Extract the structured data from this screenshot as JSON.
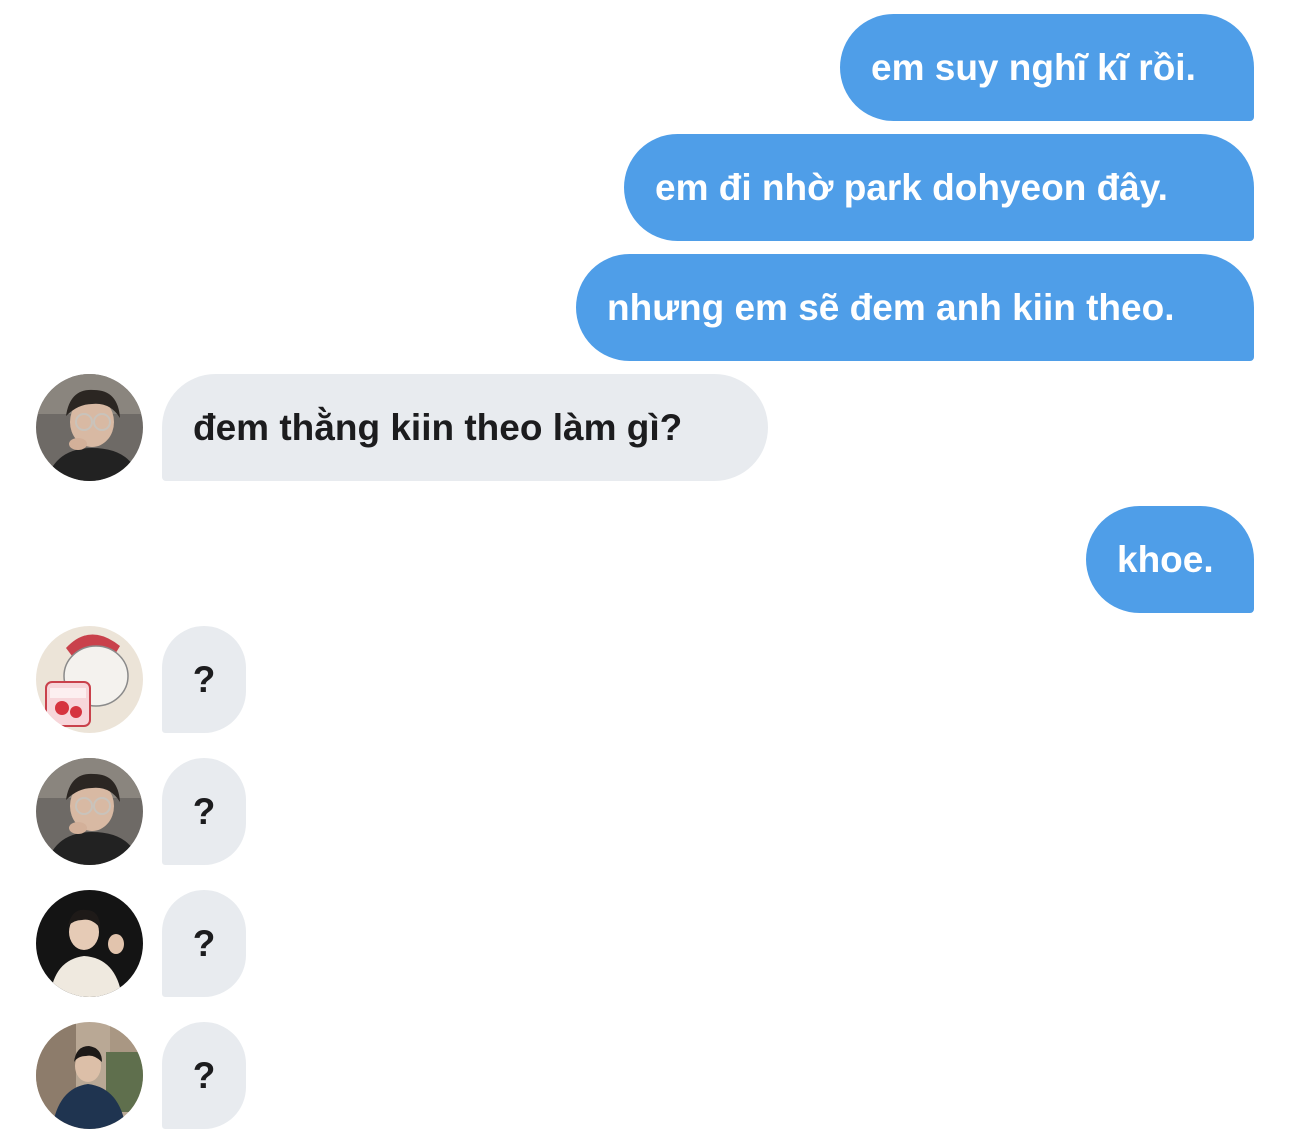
{
  "messages": [
    {
      "direction": "outgoing",
      "text": "em suy nghĩ kĩ rồi."
    },
    {
      "direction": "outgoing",
      "text": "em đi nhờ park dohyeon đây."
    },
    {
      "direction": "outgoing",
      "text": "nhưng em sẽ đem anh kiin theo."
    },
    {
      "direction": "incoming",
      "avatar": "avatar-boy-glasses",
      "text": "đem thằng kiin theo làm gì?"
    },
    {
      "direction": "outgoing",
      "text": "khoe."
    },
    {
      "direction": "incoming",
      "avatar": "avatar-cartoon-bear-icecream",
      "text": "?"
    },
    {
      "direction": "incoming",
      "avatar": "avatar-boy-glasses",
      "text": "?"
    },
    {
      "direction": "incoming",
      "avatar": "avatar-man-white-shirt",
      "text": "?"
    },
    {
      "direction": "incoming",
      "avatar": "avatar-man-street",
      "text": "?"
    }
  ],
  "colors": {
    "outgoing_bubble": "#4f9ee8",
    "incoming_bubble": "#e8ebef",
    "outgoing_text": "#ffffff",
    "incoming_text": "#1c1c1e"
  }
}
